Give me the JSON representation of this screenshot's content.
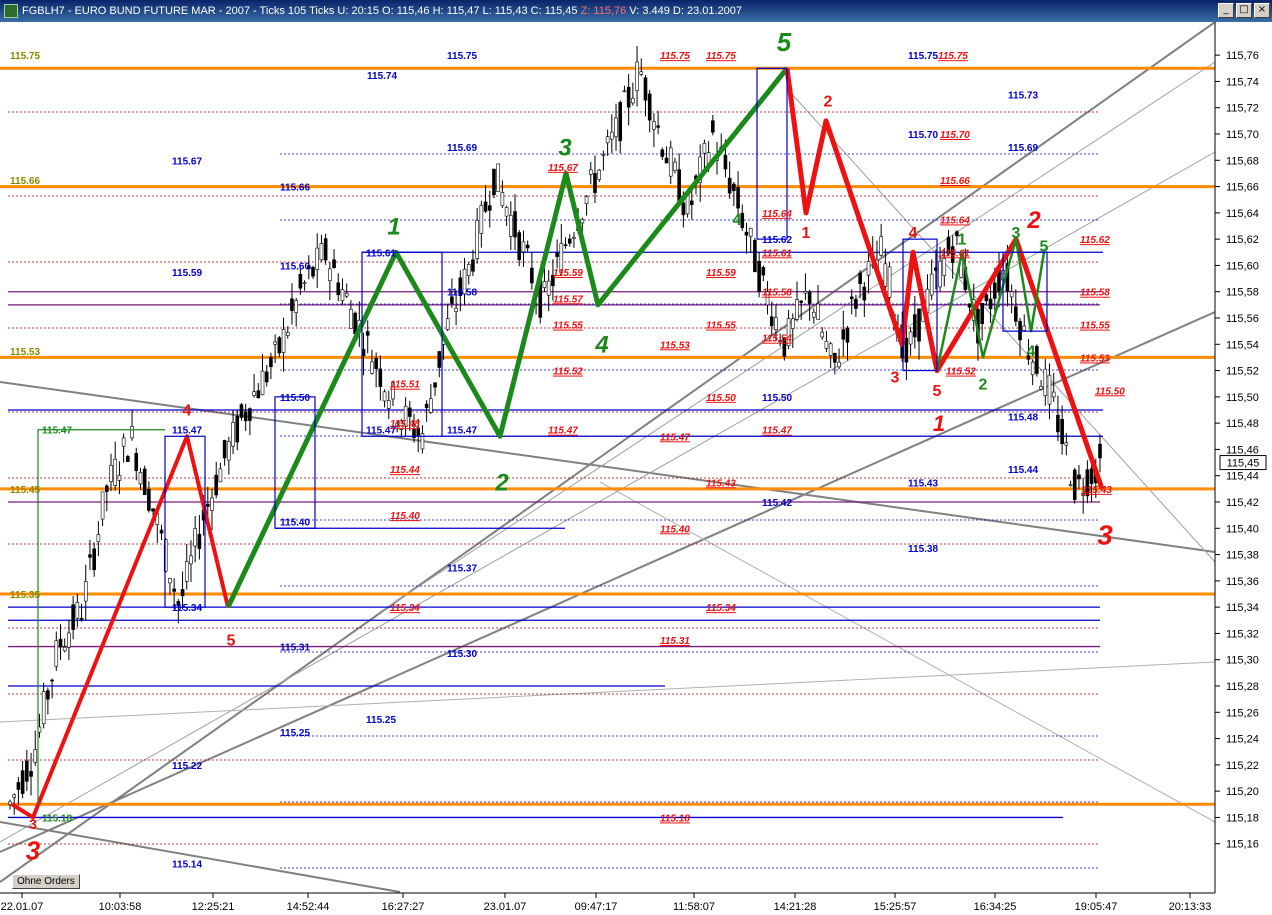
{
  "window": {
    "title_prefix": "FGBLH7 - EURO BUND FUTURE  MAR - 2007 - Ticks 105 Ticks U: 20:15  O: 115,46  H: 115,47  L: 115,43  C: 115,45 ",
    "title_z": "Z: 115,76",
    "title_suffix": " V: 3.449  D: 23.01.2007",
    "minimize_glyph": "_",
    "maximize_glyph": "□",
    "close_glyph": "×"
  },
  "controls": {
    "orders_button": "Ohne Orders"
  },
  "colors": {
    "green": "#1a8a1a",
    "red": "#ee1111",
    "orange": "#ff8c00",
    "blue": "#0000cc",
    "purple": "#7a1a7a",
    "darkred": "#aa0000",
    "gray": "#808080",
    "olive": "#8a8a00"
  },
  "chart_data": {
    "type": "candlestick",
    "ylim": [
      115.14,
      115.77
    ],
    "y_ticks": [
      "115,16",
      "115,18",
      "115,20",
      "115,22",
      "115,24",
      "115,26",
      "115,28",
      "115,30",
      "115,32",
      "115,34",
      "115,36",
      "115,38",
      "115,40",
      "115,42",
      "115,44",
      "115,46",
      "115,48",
      "115,50",
      "115,52",
      "115,54",
      "115,56",
      "115,58",
      "115,60",
      "115,62",
      "115,64",
      "115,66",
      "115,68",
      "115,70",
      "115,72",
      "115,74",
      "115,76"
    ],
    "last_price_label": "115,45",
    "last_price": 115.45,
    "x_labels": [
      "22.01.07",
      "10:03:58",
      "12:25:21",
      "14:52:44",
      "16:27:27",
      "23.01.07",
      "09:47:17",
      "11:58:07",
      "14:21:28",
      "15:25:57",
      "16:34:25",
      "19:05:47",
      "20:13:33"
    ],
    "price_path": [
      [
        0,
        115.19
      ],
      [
        1,
        115.23
      ],
      [
        2,
        115.31
      ],
      [
        3,
        115.34
      ],
      [
        4,
        115.43
      ],
      [
        5,
        115.47
      ],
      [
        6,
        115.41
      ],
      [
        7,
        115.34
      ],
      [
        8,
        115.41
      ],
      [
        9,
        115.46
      ],
      [
        10,
        115.5
      ],
      [
        11,
        115.53
      ],
      [
        12,
        115.58
      ],
      [
        13,
        115.61
      ],
      [
        14,
        115.57
      ],
      [
        15,
        115.53
      ],
      [
        16,
        115.49
      ],
      [
        17,
        115.47
      ],
      [
        18,
        115.55
      ],
      [
        19,
        115.6
      ],
      [
        20,
        115.67
      ],
      [
        21,
        115.62
      ],
      [
        22,
        115.57
      ],
      [
        23,
        115.62
      ],
      [
        24,
        115.66
      ],
      [
        25,
        115.7
      ],
      [
        26,
        115.75
      ],
      [
        27,
        115.69
      ],
      [
        28,
        115.64
      ],
      [
        29,
        115.7
      ],
      [
        30,
        115.65
      ],
      [
        31,
        115.59
      ],
      [
        32,
        115.54
      ],
      [
        33,
        115.58
      ],
      [
        34,
        115.52
      ],
      [
        35,
        115.58
      ],
      [
        36,
        115.61
      ],
      [
        37,
        115.53
      ],
      [
        38,
        115.58
      ],
      [
        39,
        115.62
      ],
      [
        40,
        115.55
      ],
      [
        41,
        115.6
      ],
      [
        42,
        115.54
      ],
      [
        43,
        115.5
      ],
      [
        44,
        115.43
      ],
      [
        45,
        115.45
      ]
    ],
    "horizontal_lines": [
      {
        "color": "orange",
        "price": 115.75,
        "x0": 0,
        "x1": 1215
      },
      {
        "color": "orange",
        "price": 115.66,
        "x0": 0,
        "x1": 1215
      },
      {
        "color": "orange",
        "price": 115.53,
        "x0": 0,
        "x1": 1215
      },
      {
        "color": "orange",
        "price": 115.43,
        "x0": 0,
        "x1": 1215
      },
      {
        "color": "orange",
        "price": 115.35,
        "x0": 0,
        "x1": 1215
      },
      {
        "color": "orange",
        "price": 115.19,
        "x0": 0,
        "x1": 1215
      },
      {
        "color": "blue",
        "price": 115.61,
        "x0": 362,
        "x1": 1103
      },
      {
        "color": "blue",
        "price": 115.49,
        "x0": 8,
        "x1": 1103
      },
      {
        "color": "blue",
        "price": 115.47,
        "x0": 442,
        "x1": 1103
      },
      {
        "color": "blue",
        "price": 115.4,
        "x0": 275,
        "x1": 565
      },
      {
        "color": "blue",
        "price": 115.34,
        "x0": 8,
        "x1": 1100
      },
      {
        "color": "blue",
        "price": 115.33,
        "x0": 8,
        "x1": 1100
      },
      {
        "color": "blue",
        "price": 115.28,
        "x0": 8,
        "x1": 665
      },
      {
        "color": "blue",
        "price": 115.18,
        "x0": 8,
        "x1": 1063
      },
      {
        "color": "purple",
        "price": 115.58,
        "x0": 8,
        "x1": 1100
      },
      {
        "color": "purple",
        "price": 115.57,
        "x0": 8,
        "x1": 1100
      },
      {
        "color": "purple",
        "price": 115.42,
        "x0": 8,
        "x1": 1100
      },
      {
        "color": "purple",
        "price": 115.31,
        "x0": 8,
        "x1": 1100
      }
    ],
    "price_labels": [
      {
        "t": "115.75",
        "c": "olive",
        "x": 10,
        "p": 115.76
      },
      {
        "t": "115.75",
        "c": "blue",
        "x": 447,
        "p": 115.76
      },
      {
        "t": "115.74",
        "c": "blue",
        "x": 367,
        "p": 115.745
      },
      {
        "t": "115.75",
        "c": "red",
        "x": 660,
        "p": 115.76
      },
      {
        "t": "115.75",
        "c": "red",
        "x": 706,
        "p": 115.76
      },
      {
        "t": "115.75",
        "c": "blue",
        "x": 908,
        "p": 115.76
      },
      {
        "t": "115.75",
        "c": "red",
        "x": 938,
        "p": 115.76
      },
      {
        "t": "115.73",
        "c": "blue",
        "x": 1008,
        "p": 115.73
      },
      {
        "t": "115.70",
        "c": "blue",
        "x": 908,
        "p": 115.7
      },
      {
        "t": "115.70",
        "c": "red",
        "x": 940,
        "p": 115.7
      },
      {
        "t": "115.69",
        "c": "blue",
        "x": 447,
        "p": 115.69
      },
      {
        "t": "115.69",
        "c": "blue",
        "x": 1008,
        "p": 115.69
      },
      {
        "t": "115.67",
        "c": "blue",
        "x": 172,
        "p": 115.68
      },
      {
        "t": "115.67",
        "c": "red",
        "x": 548,
        "p": 115.675
      },
      {
        "t": "115.66",
        "c": "olive",
        "x": 10,
        "p": 115.665
      },
      {
        "t": "115.66",
        "c": "blue",
        "x": 280,
        "p": 115.66
      },
      {
        "t": "115.66",
        "c": "red",
        "x": 940,
        "p": 115.665
      },
      {
        "t": "115.64",
        "c": "red",
        "x": 762,
        "p": 115.64
      },
      {
        "t": "115.64",
        "c": "red",
        "x": 940,
        "p": 115.635
      },
      {
        "t": "115.62",
        "c": "blue",
        "x": 762,
        "p": 115.62
      },
      {
        "t": "115.62",
        "c": "red",
        "x": 1080,
        "p": 115.62
      },
      {
        "t": "115.61",
        "c": "red",
        "x": 762,
        "p": 115.61
      },
      {
        "t": "115.61",
        "c": "red",
        "x": 940,
        "p": 115.61
      },
      {
        "t": "115.61",
        "c": "blue",
        "x": 366,
        "p": 115.61
      },
      {
        "t": "115.60",
        "c": "blue",
        "x": 280,
        "p": 115.6
      },
      {
        "t": "115.59",
        "c": "blue",
        "x": 172,
        "p": 115.595
      },
      {
        "t": "115.59",
        "c": "red",
        "x": 553,
        "p": 115.595
      },
      {
        "t": "115.59",
        "c": "red",
        "x": 706,
        "p": 115.595
      },
      {
        "t": "115.58",
        "c": "blue",
        "x": 447,
        "p": 115.58
      },
      {
        "t": "115.58",
        "c": "red",
        "x": 762,
        "p": 115.58
      },
      {
        "t": "115.58",
        "c": "red",
        "x": 1080,
        "p": 115.58
      },
      {
        "t": "115.57",
        "c": "red",
        "x": 553,
        "p": 115.575
      },
      {
        "t": "115.55",
        "c": "red",
        "x": 553,
        "p": 115.555
      },
      {
        "t": "115.55",
        "c": "red",
        "x": 706,
        "p": 115.555
      },
      {
        "t": "115.55",
        "c": "red",
        "x": 1080,
        "p": 115.555
      },
      {
        "t": "115.54",
        "c": "red",
        "x": 762,
        "p": 115.545
      },
      {
        "t": "115.53",
        "c": "olive",
        "x": 10,
        "p": 115.535
      },
      {
        "t": "115.53",
        "c": "red",
        "x": 660,
        "p": 115.54
      },
      {
        "t": "115.53",
        "c": "red",
        "x": 1080,
        "p": 115.53
      },
      {
        "t": "115.52",
        "c": "red",
        "x": 553,
        "p": 115.52
      },
      {
        "t": "115.52",
        "c": "red",
        "x": 946,
        "p": 115.52
      },
      {
        "t": "115.51",
        "c": "red",
        "x": 390,
        "p": 115.51
      },
      {
        "t": "115.50",
        "c": "blue",
        "x": 280,
        "p": 115.5
      },
      {
        "t": "115.50",
        "c": "red",
        "x": 706,
        "p": 115.5
      },
      {
        "t": "115.50",
        "c": "blue",
        "x": 762,
        "p": 115.5
      },
      {
        "t": "115.50",
        "c": "red",
        "x": 1095,
        "p": 115.505
      },
      {
        "t": "115.48",
        "c": "red",
        "x": 390,
        "p": 115.48
      },
      {
        "t": "115.48",
        "c": "blue",
        "x": 1008,
        "p": 115.485
      },
      {
        "t": "115.47",
        "c": "green",
        "x": 42,
        "p": 115.475
      },
      {
        "t": "115.47",
        "c": "blue",
        "x": 172,
        "p": 115.475
      },
      {
        "t": "115.47",
        "c": "blue",
        "x": 366,
        "p": 115.475
      },
      {
        "t": "115.47",
        "c": "blue",
        "x": 447,
        "p": 115.475
      },
      {
        "t": "115.47",
        "c": "red",
        "x": 548,
        "p": 115.475
      },
      {
        "t": "115.47",
        "c": "red",
        "x": 660,
        "p": 115.47
      },
      {
        "t": "115.47",
        "c": "red",
        "x": 762,
        "p": 115.475
      },
      {
        "t": "115.44",
        "c": "red",
        "x": 390,
        "p": 115.445
      },
      {
        "t": "115.44",
        "c": "blue",
        "x": 1008,
        "p": 115.445
      },
      {
        "t": "115.43",
        "c": "red",
        "x": 706,
        "p": 115.435
      },
      {
        "t": "115.43",
        "c": "blue",
        "x": 908,
        "p": 115.435
      },
      {
        "t": "115.43",
        "c": "red",
        "x": 1082,
        "p": 115.43
      },
      {
        "t": "115.42",
        "c": "blue",
        "x": 762,
        "p": 115.42
      },
      {
        "t": "115.40",
        "c": "blue",
        "x": 280,
        "p": 115.405
      },
      {
        "t": "115.40",
        "c": "red",
        "x": 390,
        "p": 115.41
      },
      {
        "t": "115.40",
        "c": "red",
        "x": 660,
        "p": 115.4
      },
      {
        "t": "115.38",
        "c": "blue",
        "x": 908,
        "p": 115.385
      },
      {
        "t": "115.37",
        "c": "blue",
        "x": 447,
        "p": 115.37
      },
      {
        "t": "115.35",
        "c": "olive",
        "x": 10,
        "p": 115.35
      },
      {
        "t": "115.34",
        "c": "blue",
        "x": 172,
        "p": 115.34
      },
      {
        "t": "115.34",
        "c": "red",
        "x": 390,
        "p": 115.34
      },
      {
        "t": "115.34",
        "c": "red",
        "x": 706,
        "p": 115.34
      },
      {
        "t": "115.31",
        "c": "blue",
        "x": 280,
        "p": 115.31
      },
      {
        "t": "115.31",
        "c": "red",
        "x": 660,
        "p": 115.315
      },
      {
        "t": "115.30",
        "c": "blue",
        "x": 447,
        "p": 115.305
      },
      {
        "t": "115.25",
        "c": "blue",
        "x": 366,
        "p": 115.255
      },
      {
        "t": "115.25",
        "c": "blue",
        "x": 280,
        "p": 115.245
      },
      {
        "t": "115.22",
        "c": "blue",
        "x": 172,
        "p": 115.22
      },
      {
        "t": "115.18",
        "c": "green",
        "x": 42,
        "p": 115.18
      },
      {
        "t": "115.18",
        "c": "red",
        "x": 660,
        "p": 115.18
      },
      {
        "t": "115.14",
        "c": "blue",
        "x": 172,
        "p": 115.145
      },
      {
        "t": "115.45",
        "c": "olive",
        "x": 10,
        "p": 115.43
      }
    ],
    "wave_labels": [
      {
        "t": "1",
        "c": "green",
        "x": 394,
        "p": 115.63,
        "size": 24
      },
      {
        "t": "2",
        "c": "green",
        "x": 502,
        "p": 115.435,
        "size": 24
      },
      {
        "t": "3",
        "c": "green",
        "x": 565,
        "p": 115.69,
        "size": 24
      },
      {
        "t": "4",
        "c": "green",
        "x": 602,
        "p": 115.54,
        "size": 24
      },
      {
        "t": "5",
        "c": "green",
        "x": 784,
        "p": 115.77,
        "size": 26
      },
      {
        "t": "4",
        "c": "green",
        "x": 737,
        "p": 115.635,
        "size": 16
      },
      {
        "t": "1",
        "c": "green",
        "x": 962,
        "p": 115.62,
        "size": 16
      },
      {
        "t": "2",
        "c": "green",
        "x": 983,
        "p": 115.51,
        "size": 16
      },
      {
        "t": "3",
        "c": "green",
        "x": 1016,
        "p": 115.625,
        "size": 16
      },
      {
        "t": "4",
        "c": "green",
        "x": 1031,
        "p": 115.535,
        "size": 16
      },
      {
        "t": "5",
        "c": "green",
        "x": 1044,
        "p": 115.615,
        "size": 16
      },
      {
        "t": "4",
        "c": "red",
        "x": 187,
        "p": 115.49,
        "size": 16
      },
      {
        "t": "5",
        "c": "red",
        "x": 231,
        "p": 115.315,
        "size": 16
      },
      {
        "t": "3",
        "c": "red",
        "x": 33,
        "p": 115.175,
        "size": 14
      },
      {
        "t": "3",
        "c": "red",
        "x": 33,
        "p": 115.155,
        "size": 26
      },
      {
        "t": "2",
        "c": "red",
        "x": 828,
        "p": 115.725,
        "size": 16
      },
      {
        "t": "1",
        "c": "red",
        "x": 806,
        "p": 115.625,
        "size": 16
      },
      {
        "t": "4",
        "c": "red",
        "x": 913,
        "p": 115.625,
        "size": 16
      },
      {
        "t": "3",
        "c": "red",
        "x": 895,
        "p": 115.515,
        "size": 16
      },
      {
        "t": "5",
        "c": "red",
        "x": 937,
        "p": 115.505,
        "size": 16
      },
      {
        "t": "1",
        "c": "red",
        "x": 939,
        "p": 115.48,
        "size": 22
      },
      {
        "t": "2",
        "c": "red",
        "x": 1034,
        "p": 115.635,
        "size": 24
      },
      {
        "t": "3",
        "c": "red",
        "x": 1105,
        "p": 115.395,
        "size": 28
      }
    ]
  }
}
